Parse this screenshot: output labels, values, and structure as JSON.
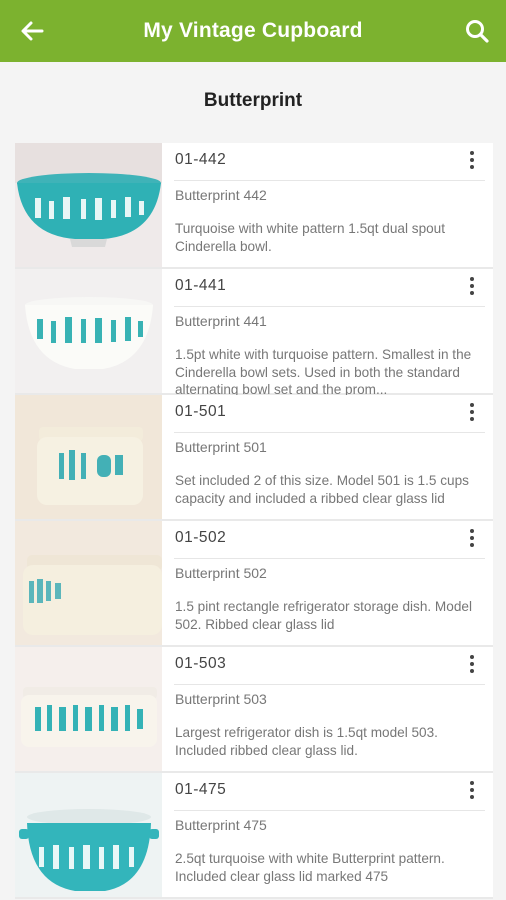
{
  "appbar": {
    "title": "My Vintage Cupboard",
    "back_icon": "arrow-left-icon",
    "search_icon": "search-icon",
    "color": "#7cb22f"
  },
  "section": {
    "title": "Butterprint"
  },
  "items": [
    {
      "code": "01-442",
      "name": "Butterprint 442",
      "desc": "Turquoise with white pattern 1.5qt dual spout Cinderella bowl."
    },
    {
      "code": "01-441",
      "name": "Butterprint 441",
      "desc": "1.5pt white with turquoise pattern.  Smallest in the Cinderella bowl sets.  Used in both the standard alternating bowl set and the prom..."
    },
    {
      "code": "01-501",
      "name": "Butterprint 501",
      "desc": "Set included 2 of this size.  Model 501 is 1.5 cups capacity and included a ribbed clear glass lid"
    },
    {
      "code": "01-502",
      "name": "Butterprint 502",
      "desc": "1.5 pint rectangle refrigerator storage dish.  Model 502.  Ribbed clear glass lid"
    },
    {
      "code": "01-503",
      "name": "Butterprint 503",
      "desc": "Largest refrigerator dish is 1.5qt model 503.  Included ribbed clear glass lid."
    },
    {
      "code": "01-475",
      "name": "Butterprint 475",
      "desc": "2.5qt turquoise with white Butterprint pattern.  Included clear glass lid marked 475"
    }
  ]
}
